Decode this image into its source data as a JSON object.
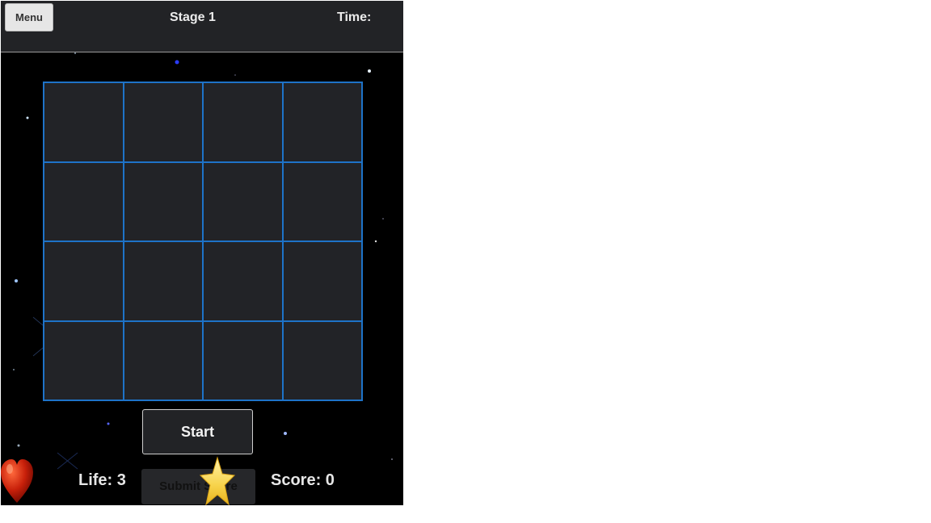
{
  "header": {
    "menu_label": "Menu",
    "stage": "Stage 1",
    "time_label": "Time:"
  },
  "grid": {
    "rows": 4,
    "cols": 4
  },
  "controls": {
    "start_label": "Start",
    "submit_label": "Submit Score"
  },
  "status": {
    "life": "Life: 3",
    "score": "Score: 0"
  },
  "icons": {
    "heart": "heart-icon",
    "star": "star-icon"
  },
  "colors": {
    "grid_line": "#1e73c8",
    "cell_fill": "#222327",
    "background": "#000000"
  }
}
